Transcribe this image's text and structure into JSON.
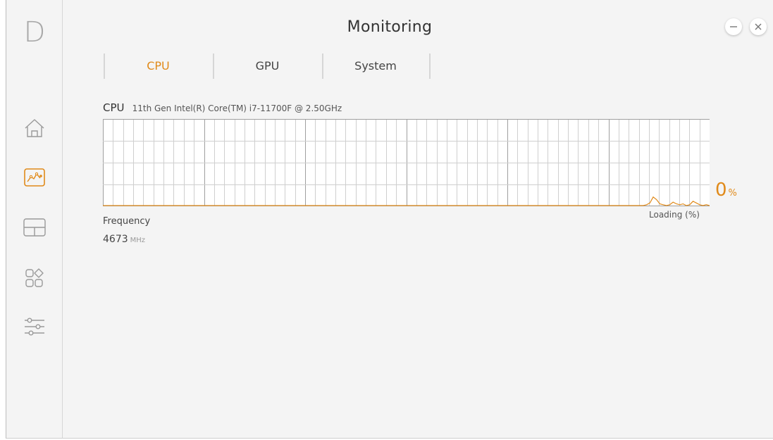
{
  "app": {
    "logo": "D",
    "title": "Monitoring"
  },
  "sidebar": {
    "items": [
      {
        "name": "home",
        "icon": "home-icon",
        "active": false
      },
      {
        "name": "monitoring",
        "icon": "chart-icon",
        "active": true
      },
      {
        "name": "layout",
        "icon": "layout-icon",
        "active": false
      },
      {
        "name": "apps",
        "icon": "apps-icon",
        "active": false
      },
      {
        "name": "settings",
        "icon": "sliders-icon",
        "active": false
      }
    ]
  },
  "window_controls": {
    "minimize_icon": "minus-icon",
    "close_icon": "close-icon"
  },
  "tabs": [
    {
      "label": "CPU",
      "active": true
    },
    {
      "label": "GPU",
      "active": false
    },
    {
      "label": "System",
      "active": false
    }
  ],
  "cpu": {
    "label": "CPU",
    "model": "11th Gen Intel(R) Core(TM) i7-11700F @ 2.50GHz",
    "load_value": "0",
    "load_unit": "%",
    "load_label": "Loading (%)",
    "frequency_label": "Frequency",
    "frequency_value": "4673",
    "frequency_unit": "MHz"
  },
  "colors": {
    "accent": "#e08a1a",
    "grid_minor": "#cfcfcf",
    "grid_major": "#9f9f9f",
    "graph_bg": "#ffffff"
  },
  "chart_data": {
    "type": "area",
    "ylim": [
      0,
      100
    ],
    "values": [
      0,
      0,
      0,
      0,
      0,
      0,
      0,
      0,
      0,
      0,
      0,
      0,
      0,
      0,
      0,
      0,
      0,
      0,
      0,
      0,
      0,
      0,
      0,
      0,
      0,
      0,
      0,
      0,
      0,
      0,
      0,
      0,
      0,
      0,
      0,
      0,
      0,
      0,
      0,
      0,
      0,
      0,
      0,
      0,
      0,
      0,
      0,
      0,
      0,
      0,
      0,
      0,
      0,
      0,
      0,
      0,
      0,
      0,
      0,
      0,
      0,
      0,
      0,
      0,
      0,
      0,
      0,
      0,
      0,
      0,
      0,
      0,
      0,
      0,
      0,
      0,
      0,
      0,
      0,
      0,
      0,
      0,
      0,
      0,
      0,
      0,
      0,
      0,
      0,
      0,
      0,
      0,
      0,
      0,
      0,
      0,
      0,
      0,
      0,
      0,
      0,
      0,
      0,
      0,
      0,
      0,
      0,
      0,
      0,
      0,
      0,
      0,
      0,
      0,
      0,
      0,
      0,
      0,
      0,
      0,
      0,
      0,
      0,
      0,
      0,
      0,
      0,
      0,
      0,
      0,
      0,
      0,
      0,
      0,
      0,
      0,
      0,
      0,
      0,
      0,
      0,
      0,
      0,
      0,
      0,
      0,
      0,
      0,
      0,
      0,
      0,
      0,
      0,
      0,
      0,
      0,
      0,
      0,
      0,
      0,
      0,
      0,
      0,
      0,
      1,
      3,
      10,
      7,
      2,
      1,
      0,
      1,
      4,
      2,
      1,
      2,
      0,
      1,
      5,
      3,
      1,
      0,
      1,
      0
    ]
  }
}
